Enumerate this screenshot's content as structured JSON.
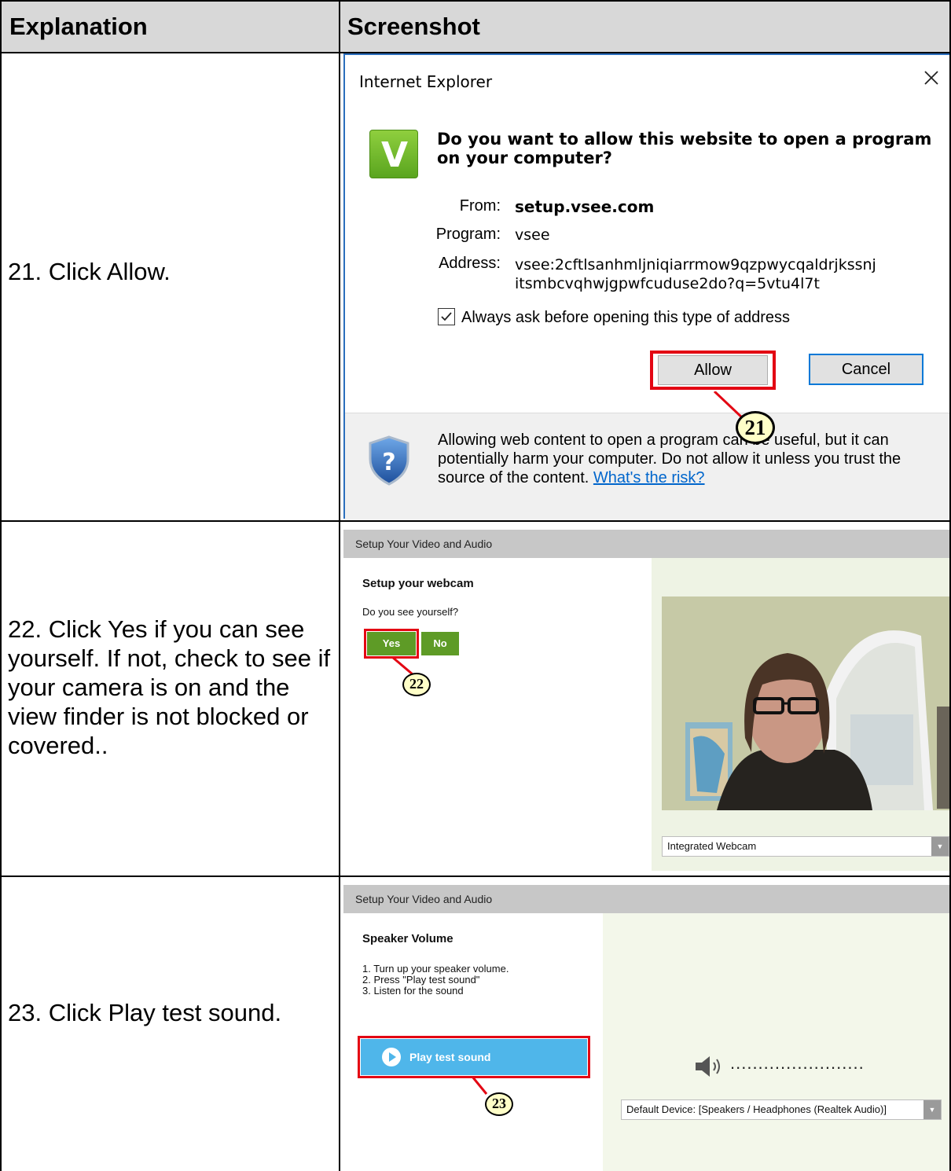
{
  "table": {
    "header": {
      "explanation": "Explanation",
      "screenshot": "Screenshot"
    }
  },
  "steps": [
    {
      "explanation": "21. Click Allow."
    },
    {
      "explanation": "22. Click Yes if you can see yourself.  If not, check to see if your camera is on and the view finder is not blocked or covered.."
    },
    {
      "explanation": "23. Click Play test sound."
    }
  ],
  "ie_dialog": {
    "title": "Internet Explorer",
    "logo_letter": "V",
    "question": "Do you want to allow this website to open a program on your computer?",
    "from_label": "From:",
    "from_value": "setup.vsee.com",
    "program_label": "Program:",
    "program_value": "vsee",
    "address_label": "Address:",
    "address_line1": "vsee:2cftlsanhmljniqiarrmow9qzpwycqaldrjkssnj",
    "address_line2": "itsmbcvqhwjgpwfcuduse2do?q=5vtu4l7t",
    "checkbox_label": "Always ask before opening this type of address",
    "checkbox_checked": true,
    "allow_button": "Allow",
    "cancel_button": "Cancel",
    "warning_text": "Allowing web content to open a program can be useful, but it can potentially harm your computer. Do not allow it unless you trust the source of the content.",
    "risk_link": "What's the risk?",
    "callout_number": "21",
    "icons": {
      "close": "close-icon",
      "shield": "shield-question-icon"
    },
    "colors": {
      "highlight": "#e30613",
      "link": "#0066cc",
      "logo": "#6cb52d"
    }
  },
  "webcam_setup": {
    "window_title": "Setup Your Video and Audio",
    "heading": "Setup your webcam",
    "question": "Do you see yourself?",
    "yes_button": "Yes",
    "no_button": "No",
    "callout_number": "22",
    "camera_select": "Integrated Webcam"
  },
  "speaker_setup": {
    "window_title": "Setup Your Video and Audio",
    "heading": "Speaker Volume",
    "instructions": [
      "1. Turn up your speaker volume.",
      "2. Press \"Play test sound\"",
      "3. Listen for the sound"
    ],
    "play_button": "Play test sound",
    "callout_number": "23",
    "volume_dots": "........................",
    "device_select": "Default Device: [Speakers / Headphones (Realtek Audio)]",
    "icons": {
      "play": "play-icon",
      "speaker": "speaker-icon"
    },
    "colors": {
      "play_button": "#4fb6ea"
    }
  }
}
